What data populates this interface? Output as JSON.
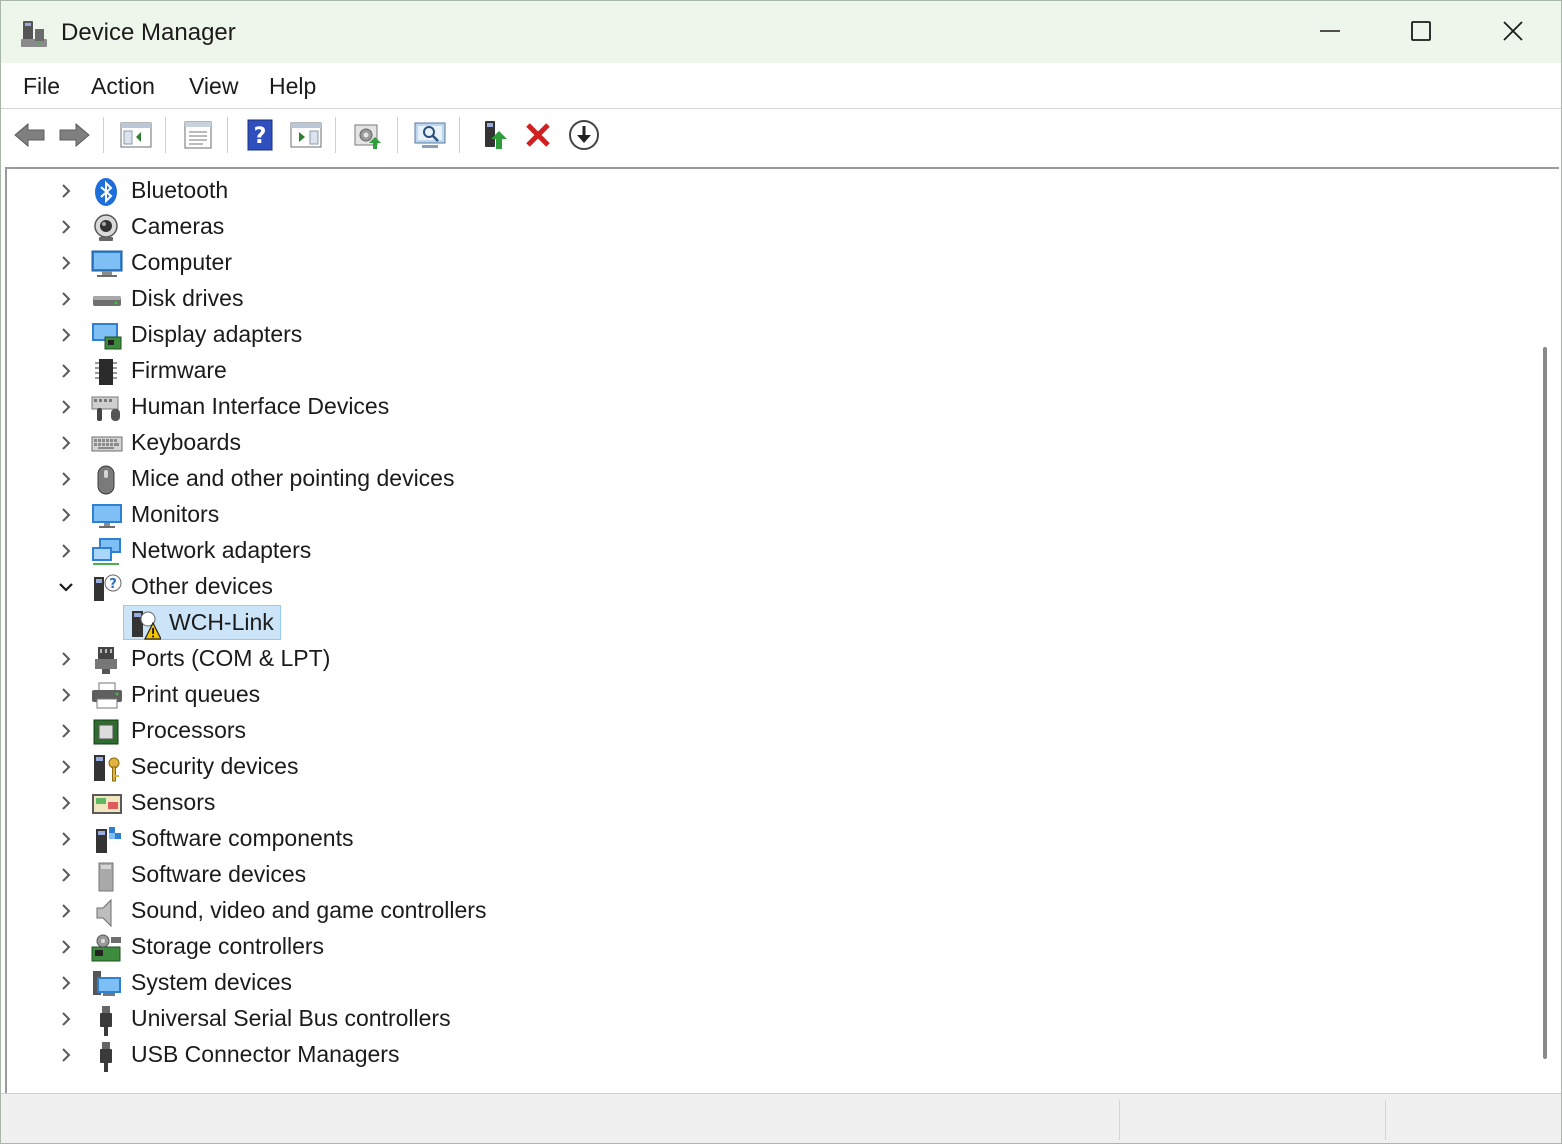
{
  "window": {
    "title": "Device Manager",
    "minimize_label": "Minimize",
    "maximize_label": "Maximize",
    "close_label": "Close"
  },
  "menubar": {
    "items": [
      "File",
      "Action",
      "View",
      "Help"
    ]
  },
  "toolbar": {
    "buttons": [
      {
        "icon": "back-arrow-icon"
      },
      {
        "icon": "forward-arrow-icon"
      },
      {
        "icon": "show-hide-console-tree-icon"
      },
      {
        "icon": "properties-icon"
      },
      {
        "icon": "help-icon"
      },
      {
        "icon": "show-action-pane-icon"
      },
      {
        "icon": "update-driver-icon"
      },
      {
        "icon": "scan-hardware-changes-icon"
      },
      {
        "icon": "enable-device-icon"
      },
      {
        "icon": "uninstall-device-icon"
      },
      {
        "icon": "disable-device-icon"
      }
    ]
  },
  "tree": {
    "categories": [
      {
        "label": "Bluetooth",
        "icon": "bluetooth-icon",
        "expanded": false
      },
      {
        "label": "Cameras",
        "icon": "camera-icon",
        "expanded": false
      },
      {
        "label": "Computer",
        "icon": "computer-icon",
        "expanded": false
      },
      {
        "label": "Disk drives",
        "icon": "disk-drive-icon",
        "expanded": false
      },
      {
        "label": "Display adapters",
        "icon": "display-adapter-icon",
        "expanded": false
      },
      {
        "label": "Firmware",
        "icon": "firmware-icon",
        "expanded": false
      },
      {
        "label": "Human Interface Devices",
        "icon": "hid-icon",
        "expanded": false
      },
      {
        "label": "Keyboards",
        "icon": "keyboard-icon",
        "expanded": false
      },
      {
        "label": "Mice and other pointing devices",
        "icon": "mouse-icon",
        "expanded": false
      },
      {
        "label": "Monitors",
        "icon": "monitor-icon",
        "expanded": false
      },
      {
        "label": "Network adapters",
        "icon": "network-adapter-icon",
        "expanded": false
      },
      {
        "label": "Other devices",
        "icon": "other-devices-icon",
        "expanded": true,
        "children": [
          {
            "label": "WCH-Link",
            "icon": "unknown-device-warning-icon",
            "selected": true
          }
        ]
      },
      {
        "label": "Ports (COM & LPT)",
        "icon": "port-icon",
        "expanded": false
      },
      {
        "label": "Print queues",
        "icon": "printer-icon",
        "expanded": false
      },
      {
        "label": "Processors",
        "icon": "processor-icon",
        "expanded": false
      },
      {
        "label": "Security devices",
        "icon": "security-device-icon",
        "expanded": false
      },
      {
        "label": "Sensors",
        "icon": "sensor-icon",
        "expanded": false
      },
      {
        "label": "Software components",
        "icon": "software-component-icon",
        "expanded": false
      },
      {
        "label": "Software devices",
        "icon": "software-device-icon",
        "expanded": false
      },
      {
        "label": "Sound, video and game controllers",
        "icon": "speaker-icon",
        "expanded": false
      },
      {
        "label": "Storage controllers",
        "icon": "storage-controller-icon",
        "expanded": false
      },
      {
        "label": "System devices",
        "icon": "system-device-icon",
        "expanded": false
      },
      {
        "label": "Universal Serial Bus controllers",
        "icon": "usb-icon",
        "expanded": false
      },
      {
        "label": "USB Connector Managers",
        "icon": "usb-connector-icon",
        "expanded": false
      }
    ]
  },
  "colors": {
    "titlebar": "#eef5ea",
    "selection": "#cce4f7",
    "selection_border": "#99c9ef"
  }
}
